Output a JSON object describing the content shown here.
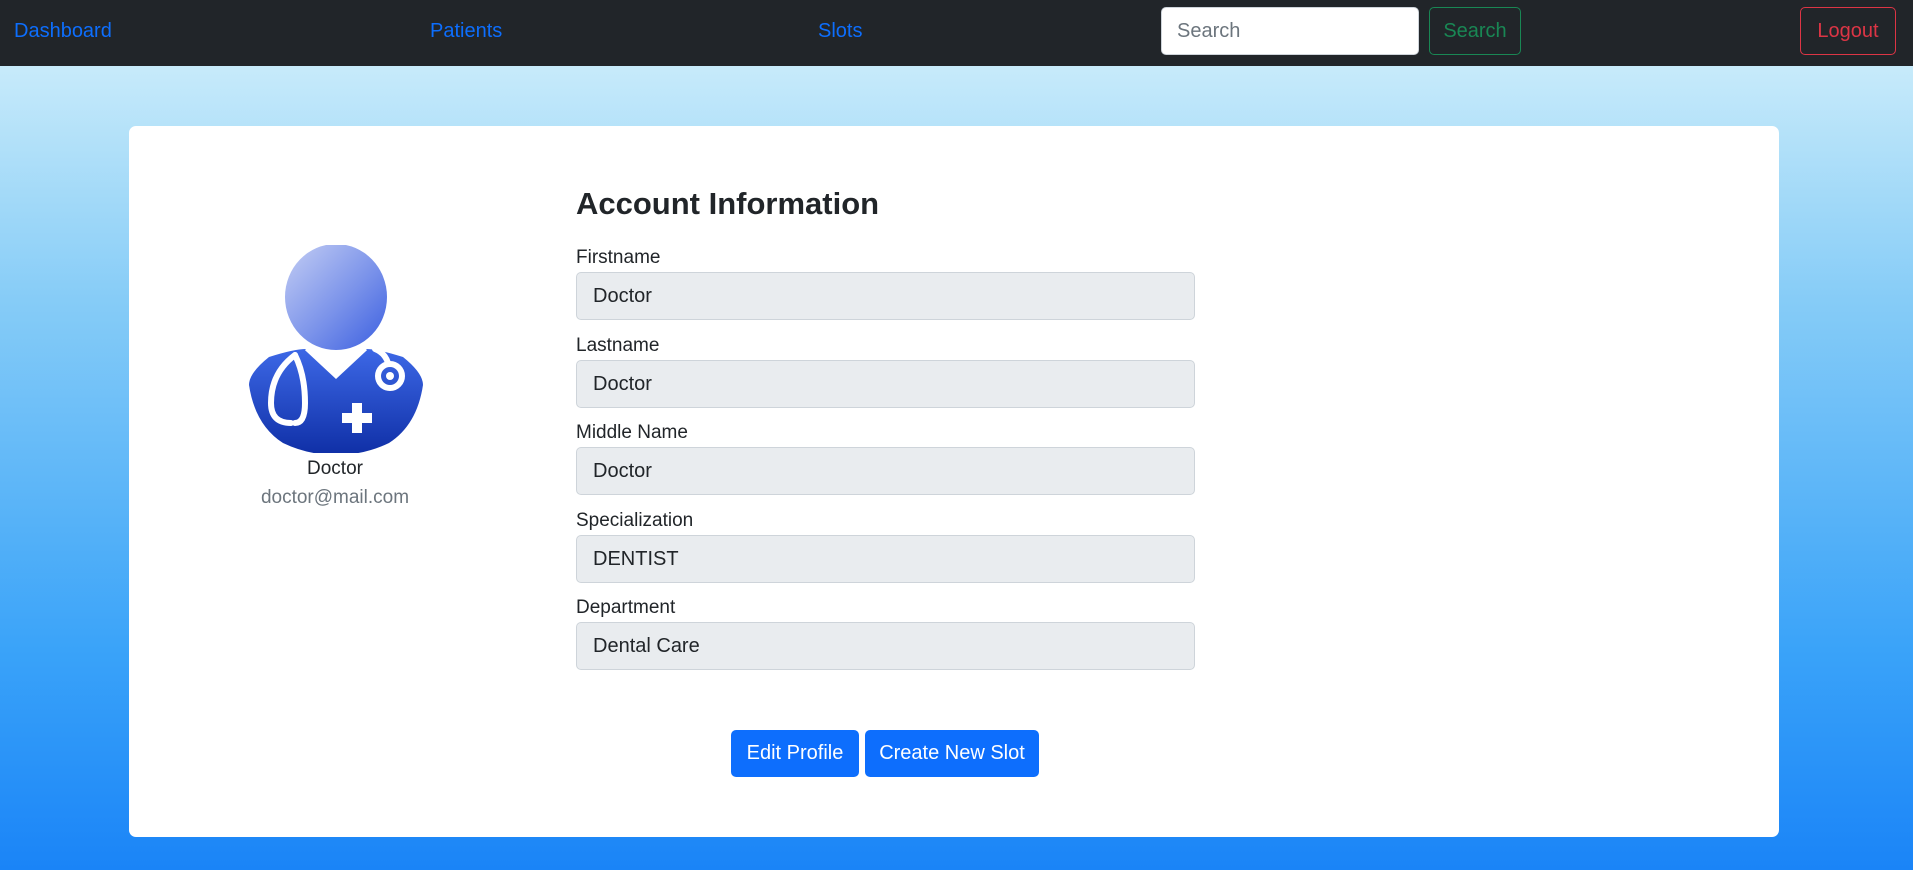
{
  "nav": {
    "dashboard": "Dashboard",
    "patients": "Patients",
    "slots": "Slots",
    "search_placeholder": "Search",
    "search_button": "Search",
    "logout_button": "Logout"
  },
  "profile": {
    "avatar_icon": "doctor-avatar-icon",
    "name": "Doctor",
    "email": "doctor@mail.com"
  },
  "account": {
    "title": "Account Information",
    "fields": [
      {
        "label": "Firstname",
        "value": "Doctor"
      },
      {
        "label": "Lastname",
        "value": "Doctor"
      },
      {
        "label": "Middle Name",
        "value": "Doctor"
      },
      {
        "label": "Specialization",
        "value": "DENTIST"
      },
      {
        "label": "Department",
        "value": "Dental Care"
      }
    ]
  },
  "actions": {
    "edit_profile": "Edit Profile",
    "create_slot": "Create New Slot"
  },
  "colors": {
    "navbar": "#212529",
    "link": "#0d6efd",
    "success": "#198754",
    "danger": "#dc3545",
    "primary": "#0d6efd",
    "readonly_input": "#e9ecef"
  }
}
